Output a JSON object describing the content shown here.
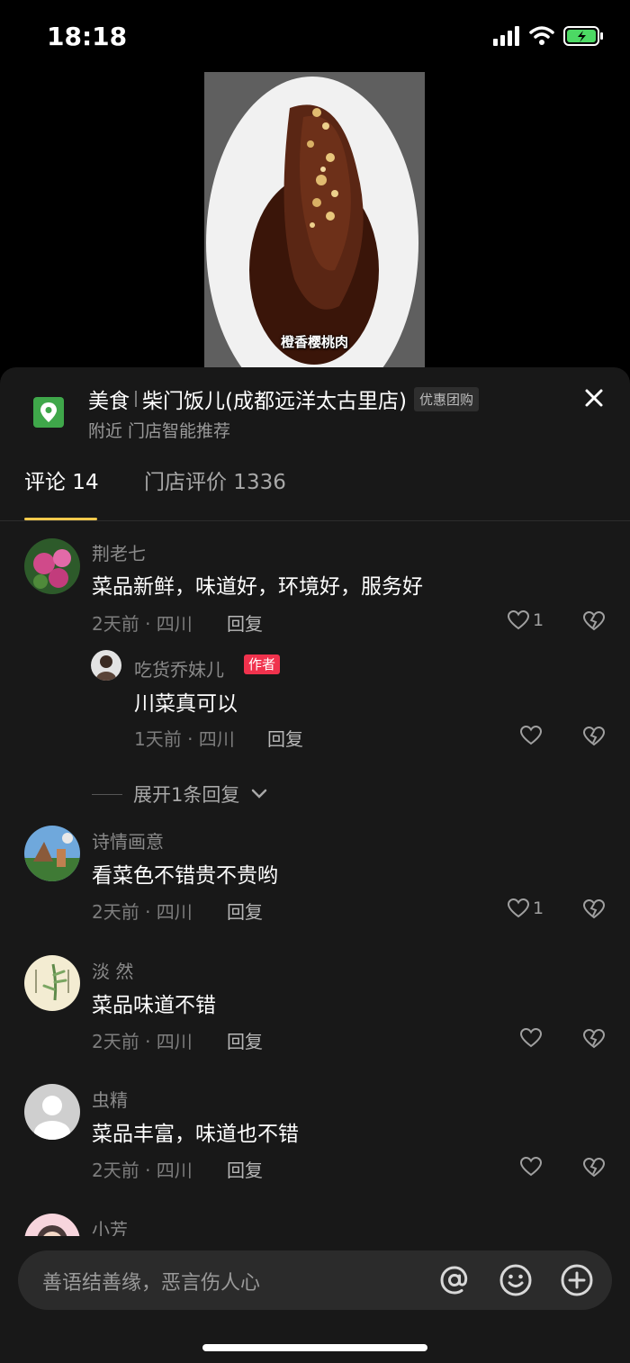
{
  "status_bar": {
    "time": "18:18"
  },
  "video": {
    "caption": "橙香樱桃肉"
  },
  "store": {
    "category": "美食",
    "name": "柴门饭儿(成都远洋太古里店)",
    "promo": "优惠团购",
    "sub": "附近 门店智能推荐"
  },
  "tabs": [
    {
      "label": "评论 14"
    },
    {
      "label": "门店评价 1336"
    }
  ],
  "reply_label": "回复",
  "comments": [
    {
      "user": "荆老七",
      "text": "菜品新鲜，味道好，环境好，服务好",
      "meta": "2天前 · 四川",
      "likes": "1"
    },
    {
      "user": "诗情画意",
      "text": "看菜色不错贵不贵哟",
      "meta": "2天前 · 四川",
      "likes": "1"
    },
    {
      "user": "淡 然",
      "text": "菜品味道不错",
      "meta": "2天前 · 四川",
      "likes": ""
    },
    {
      "user": "虫精",
      "text": "菜品丰富，味道也不错",
      "meta": "2天前 · 四川",
      "likes": ""
    },
    {
      "user": "小芳",
      "text": "",
      "meta": "",
      "likes": ""
    }
  ],
  "reply": {
    "user": "吃货乔妹儿",
    "badge": "作者",
    "text": "川菜真可以",
    "meta": "1天前 · 四川"
  },
  "expand": {
    "label": "展开1条回复"
  },
  "input": {
    "placeholder": "善语结善缘，恶言伤人心"
  },
  "colors": {
    "accent_tab": "#f2c94c",
    "author_badge": "#f0324d",
    "location_icon": "#3fa74a",
    "battery": "#4cd964"
  }
}
